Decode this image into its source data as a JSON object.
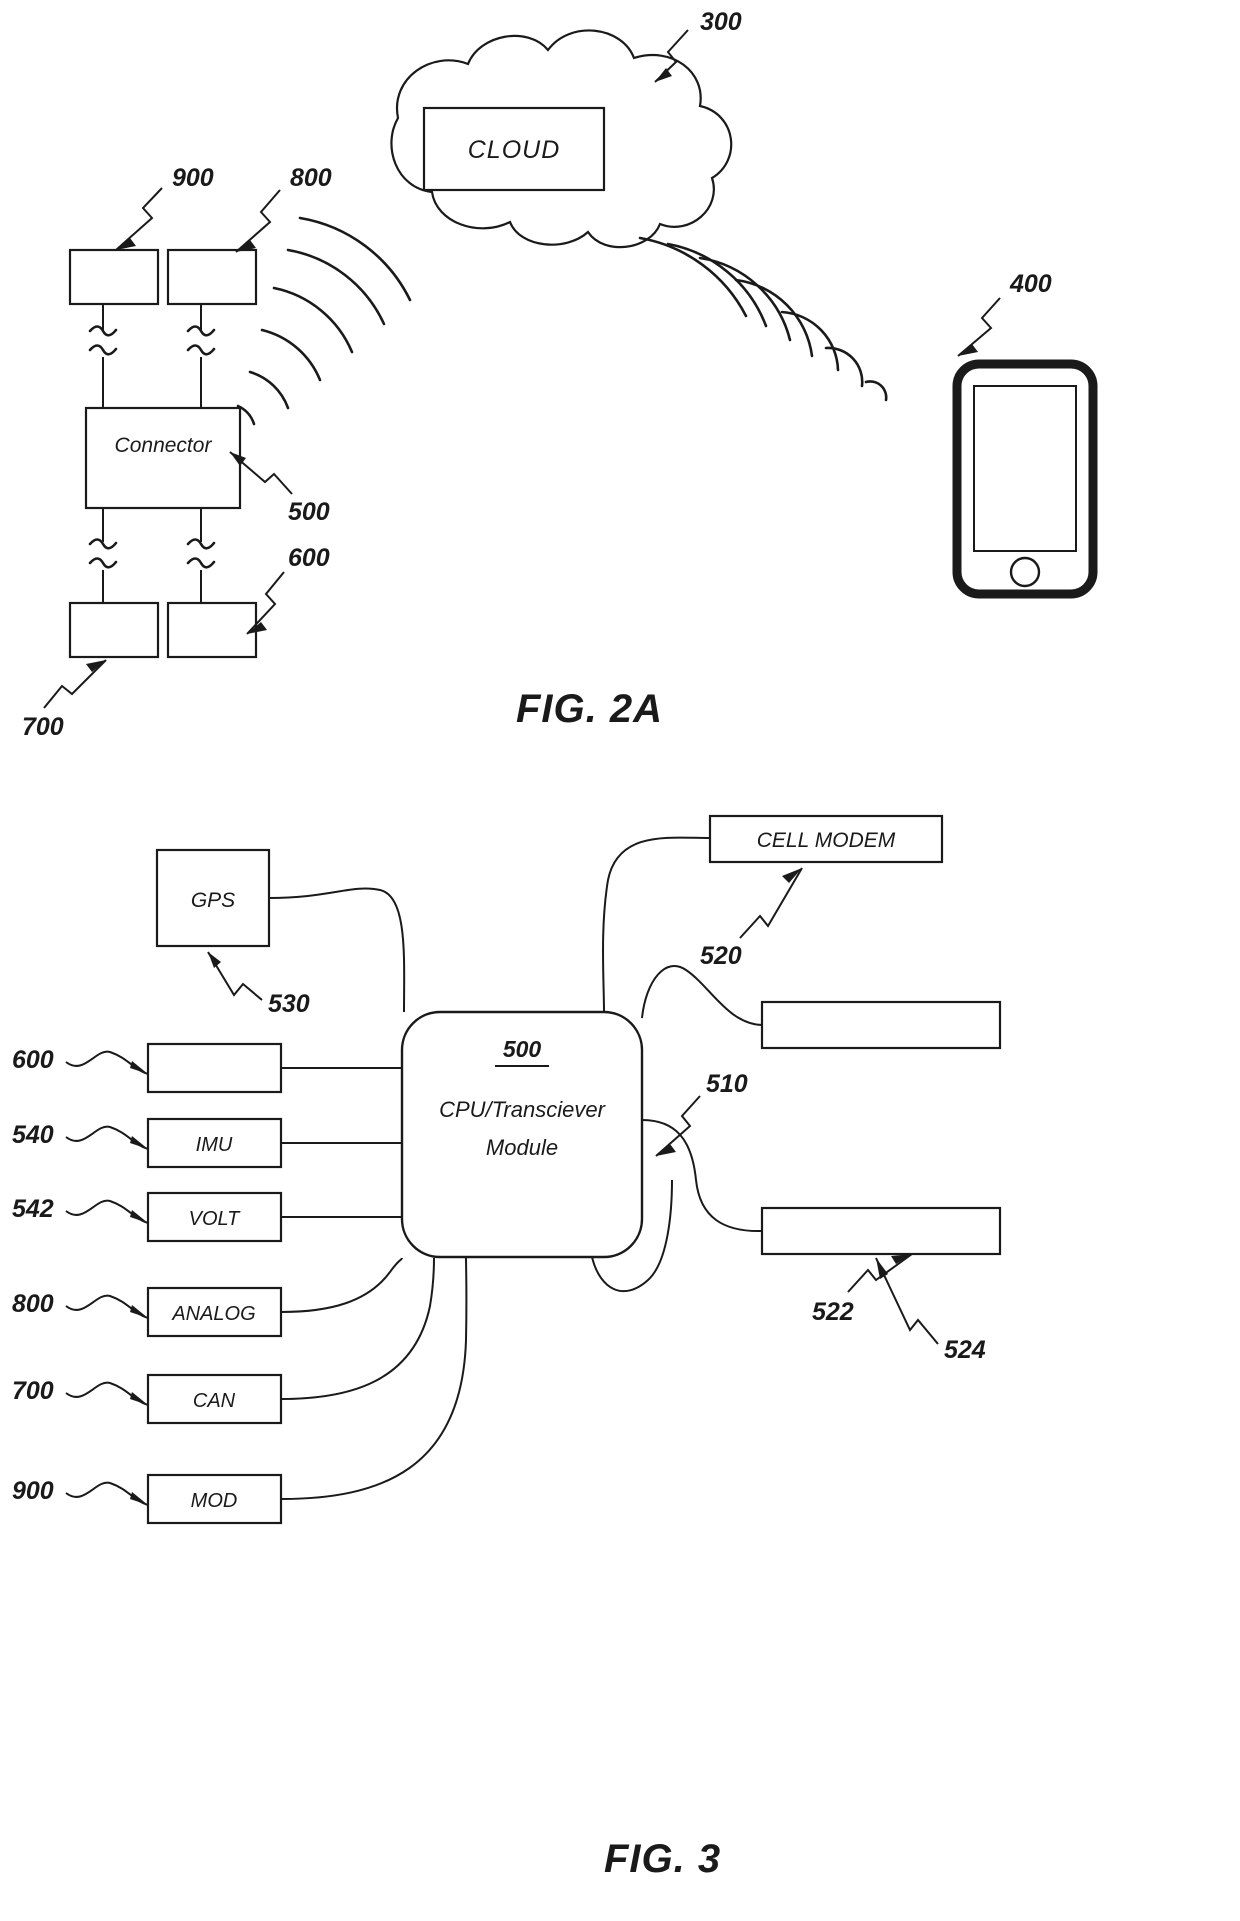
{
  "document": {
    "type": "patent-drawing-sheet",
    "figures": [
      "FIG. 2A",
      "FIG. 3"
    ]
  },
  "fig2a": {
    "caption": "FIG. 2A",
    "cloud": {
      "label": "CLOUD",
      "ref": "300"
    },
    "connector": {
      "label": "Connector",
      "ref": "500"
    },
    "top_left_box": {
      "label": "",
      "ref": "900"
    },
    "top_right_box": {
      "label": "",
      "ref": "800"
    },
    "bottom_left_box": {
      "label": "",
      "ref": "700"
    },
    "bottom_right_box": {
      "label": "",
      "ref": "600"
    },
    "phone": {
      "label": "",
      "ref": "400"
    },
    "refs": [
      "300",
      "400",
      "500",
      "600",
      "700",
      "800",
      "900"
    ]
  },
  "fig3": {
    "caption": "FIG. 3",
    "cpu": {
      "ref": "500",
      "line1": "CPU/Transciever",
      "line2": "Module"
    },
    "gps": {
      "label": "GPS",
      "ref": "530"
    },
    "cell_modem": {
      "label": "CELL MODEM",
      "ref": "520"
    },
    "left_inputs": [
      {
        "label": "",
        "ref": "600"
      },
      {
        "label": "IMU",
        "ref": "540"
      },
      {
        "label": "VOLT",
        "ref": "542"
      },
      {
        "label": "ANALOG",
        "ref": "800"
      },
      {
        "label": "CAN",
        "ref": "700"
      },
      {
        "label": "MOD",
        "ref": "900"
      }
    ],
    "right_outputs": [
      {
        "label": "",
        "ref": "522"
      },
      {
        "label": "",
        "ref": "524"
      }
    ],
    "bus_ref": "510"
  },
  "colors": {
    "ink": "#1a1a1a",
    "paper": "#ffffff"
  }
}
